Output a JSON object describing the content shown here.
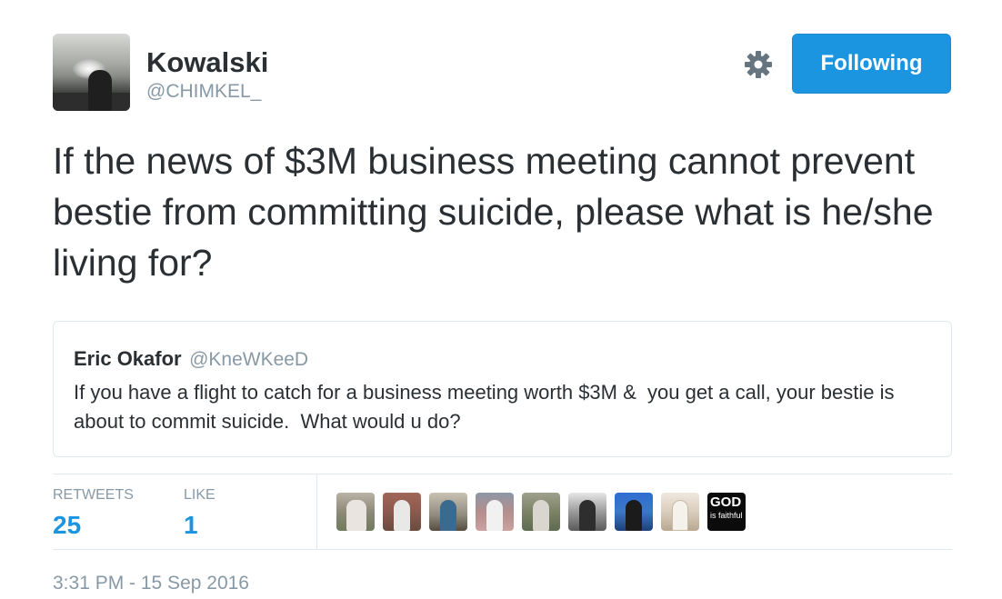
{
  "author": {
    "name": "Kowalski",
    "handle": "@CHIMKEL_",
    "avatar_icon": "profile-photo"
  },
  "actions": {
    "settings_icon": "gear-icon",
    "follow_label": "Following",
    "follow_color": "#1b95e0"
  },
  "tweet": {
    "text": "If the news of $3M business meeting cannot prevent bestie from committing suicide, please what is he/she living for?"
  },
  "quoted": {
    "name": "Eric Okafor",
    "handle": "@KneWKeeD",
    "text": "If you have a flight to catch for a business meeting worth $3M &  you get a call, your bestie is about to commit suicide.  What would u do?"
  },
  "stats": {
    "retweets_label": "RETWEETS",
    "retweets_value": "25",
    "likes_label": "LIKE",
    "likes_value": "1"
  },
  "likers": [
    {
      "icon": "liker-avatar-1"
    },
    {
      "icon": "liker-avatar-2"
    },
    {
      "icon": "liker-avatar-3"
    },
    {
      "icon": "liker-avatar-4"
    },
    {
      "icon": "liker-avatar-5"
    },
    {
      "icon": "liker-avatar-6"
    },
    {
      "icon": "liker-avatar-7"
    },
    {
      "icon": "liker-avatar-8"
    },
    {
      "icon": "liker-avatar-9",
      "text_main": "GOD",
      "text_sub": "is faithful"
    }
  ],
  "timestamp": "3:31 PM - 15 Sep 2016",
  "colors": {
    "accent": "#1b95e0",
    "muted": "#8899a6",
    "text": "#292f33",
    "border": "#e1e8ed"
  }
}
